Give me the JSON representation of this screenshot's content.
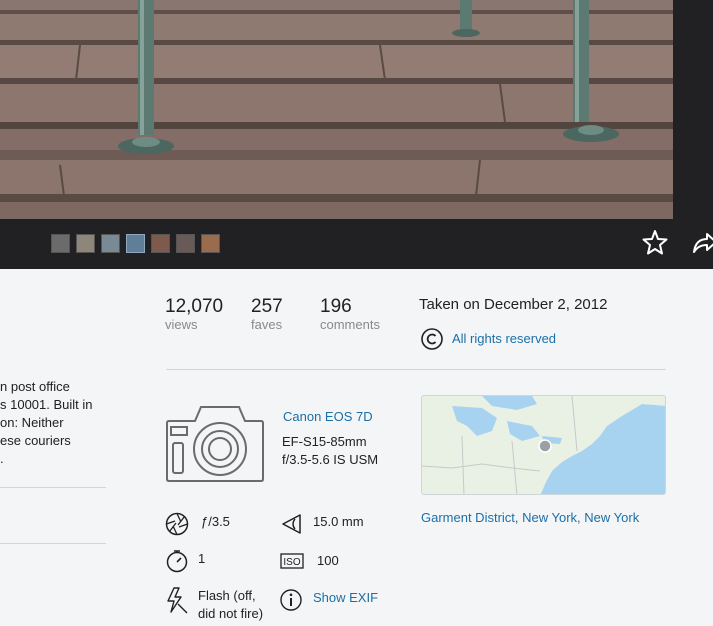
{
  "toolbar": {
    "fave_icon": "star-icon",
    "share_icon": "share-icon"
  },
  "filmstrip": {
    "thumbs": [
      "#6b6b6b",
      "#8d8679",
      "#7a8a95",
      "#5f7f98",
      "#7d5a4c",
      "#6a5a57",
      "#9b6b4e"
    ]
  },
  "description": {
    "lines": [
      "n post office",
      "s 10001. Built in",
      "on: Neither",
      "ese couriers",
      "."
    ]
  },
  "stats": {
    "views": {
      "value": "12,070",
      "label": "views"
    },
    "faves": {
      "value": "257",
      "label": "faves"
    },
    "comments": {
      "value": "196",
      "label": "comments"
    }
  },
  "taken": "Taken on December 2, 2012",
  "rights": {
    "label": "All rights reserved",
    "icon": "copyright-icon"
  },
  "camera": {
    "model": "Canon EOS 7D",
    "lens_line1": "EF-S15-85mm",
    "lens_line2": "f/3.5-5.6 IS USM",
    "icon": "camera-icon"
  },
  "exif": {
    "aperture": "ƒ/3.5",
    "focal_length": "15.0 mm",
    "exposure": "1",
    "iso": "100",
    "flash_line1": "Flash (off,",
    "flash_line2": "did not fire)",
    "show_exif": "Show EXIF"
  },
  "location": "Garment District, New York, New York",
  "colors": {
    "link": "#1c6fa8",
    "dark_bg": "#212124",
    "page_bg": "#f3f5f6"
  }
}
